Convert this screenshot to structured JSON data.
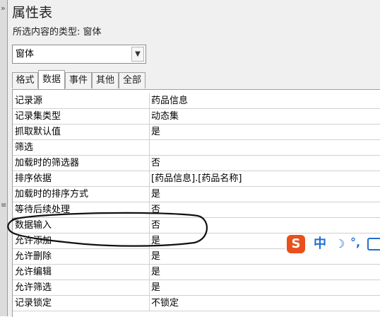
{
  "panel": {
    "title": "属性表",
    "selection_type_label": "所选内容的类型: 窗体"
  },
  "object_select": {
    "value": "窗体"
  },
  "tabs": [
    {
      "label": "格式"
    },
    {
      "label": "数据"
    },
    {
      "label": "事件"
    },
    {
      "label": "其他"
    },
    {
      "label": "全部"
    }
  ],
  "active_tab": "数据",
  "properties": [
    {
      "name": "记录源",
      "value": "药品信息"
    },
    {
      "name": "记录集类型",
      "value": "动态集"
    },
    {
      "name": "抓取默认值",
      "value": "是"
    },
    {
      "name": "筛选",
      "value": ""
    },
    {
      "name": "加载时的筛选器",
      "value": "否"
    },
    {
      "name": "排序依据",
      "value": "[药品信息].[药品名称]"
    },
    {
      "name": "加载时的排序方式",
      "value": "是"
    },
    {
      "name": "等待后续处理",
      "value": "否"
    },
    {
      "name": "数据输入",
      "value": "否"
    },
    {
      "name": "允许添加",
      "value": "是"
    },
    {
      "name": "允许删除",
      "value": "是"
    },
    {
      "name": "允许编辑",
      "value": "是"
    },
    {
      "name": "允许筛选",
      "value": "是"
    },
    {
      "name": "记录锁定",
      "value": "不锁定"
    }
  ],
  "ime_toolbar": {
    "logo": "S",
    "mode": "中",
    "punctuation": "°,",
    "icons": [
      "moon-icon",
      "keyboard-icon"
    ]
  },
  "colors": {
    "panel_bg": "#f0f0f0",
    "annotation_stroke": "#111111",
    "ime_logo": "#e8501c",
    "ime_accent": "#1f6fd0"
  }
}
